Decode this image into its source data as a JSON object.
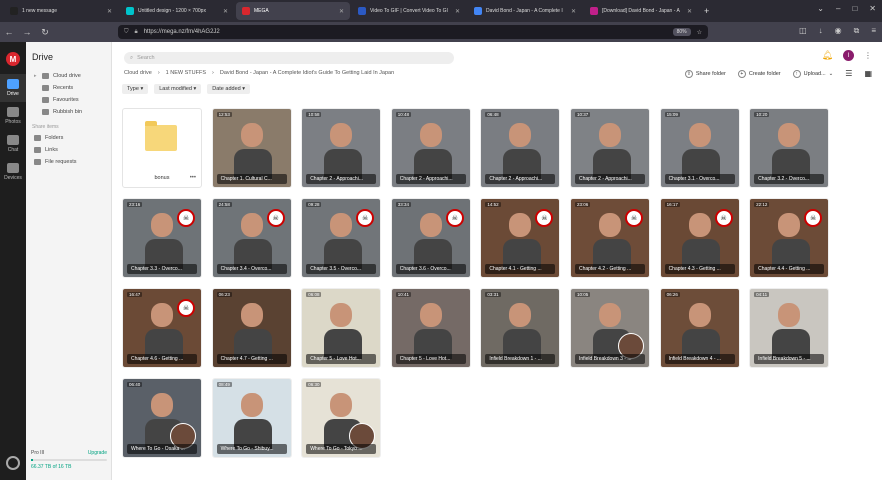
{
  "browser": {
    "tabs": [
      {
        "label": "1 new message",
        "color": "#222"
      },
      {
        "label": "Untitled design - 1200 × 700px",
        "color": "#00c4cc"
      },
      {
        "label": "MEGA",
        "color": "#d9272e",
        "active": true
      },
      {
        "label": "Video To GIF | Convert Video To GI",
        "color": "#2b59c3"
      },
      {
        "label": "David Bond - Japan - A Complete I",
        "color": "#4285f4"
      },
      {
        "label": "[Download] David Bond - Japan - A",
        "color": "#c0208a"
      }
    ],
    "new_tab": "+",
    "url": "https://mega.nz/fm/4hAG2J2",
    "zoom": "80%"
  },
  "rail": {
    "logo": "M",
    "items": [
      {
        "label": "Drive",
        "active": true
      },
      {
        "label": "Photos"
      },
      {
        "label": "Chat"
      },
      {
        "label": "Devices"
      }
    ]
  },
  "sidebar": {
    "title": "Drive",
    "items": [
      "Cloud drive",
      "Recents",
      "Favourites",
      "Rubbish bin"
    ],
    "section": "Share items",
    "share_items": [
      "Folders",
      "Links",
      "File requests"
    ],
    "storage": {
      "plan": "Pro III",
      "upgrade": "Upgrade",
      "used": "66.37 TB of 16 TB",
      "fraction": 0.03
    }
  },
  "main": {
    "search_placeholder": "Search",
    "avatar": "I",
    "breadcrumb": [
      "Cloud drive",
      "1 NEW STUFFS",
      "David Bond - Japan - A Complete Idiot's Guide To Getting Laid In Japan"
    ],
    "actions": [
      "Share folder",
      "Create folder",
      "Upload..."
    ],
    "filters": [
      "Type",
      "Last modified",
      "Date added"
    ],
    "folder": {
      "name": "bonus"
    },
    "files": [
      {
        "name": "Chapter 1. Cultural C...",
        "dur": "12:53",
        "bg": "#8a7b6a"
      },
      {
        "name": "Chapter 2 - Approachi...",
        "dur": "10:58",
        "bg": "#7c7f84"
      },
      {
        "name": "Chapter 2 - Approachi...",
        "dur": "10:48",
        "bg": "#7b7e83"
      },
      {
        "name": "Chapter 2 - Approachi...",
        "dur": "06:48",
        "bg": "#7a7d82"
      },
      {
        "name": "Chapter 2 - Approachi...",
        "dur": "10:37",
        "bg": "#7f8286"
      },
      {
        "name": "Chapter 3.1 - Overco...",
        "dur": "15:09",
        "bg": "#7c7f84"
      },
      {
        "name": "Chapter 3.2 - Overco...",
        "dur": "10:20",
        "bg": "#7b7e82"
      },
      {
        "name": "Chapter 3.3 - Overco...",
        "dur": "23:16",
        "bg": "#6e7377",
        "badge": true
      },
      {
        "name": "Chapter 3.4 - Overco...",
        "dur": "24:58",
        "bg": "#6f7478",
        "badge": true
      },
      {
        "name": "Chapter 3.5 - Overco...",
        "dur": "09:28",
        "bg": "#717579",
        "badge": true
      },
      {
        "name": "Chapter 3.6 - Overco...",
        "dur": "33:34",
        "bg": "#6e7276",
        "badge": true
      },
      {
        "name": "Chapter 4.1 - Getting ...",
        "dur": "14:52",
        "bg": "#6b4a36",
        "badge": true
      },
      {
        "name": "Chapter 4.2 - Getting ...",
        "dur": "23:06",
        "bg": "#6e4c38",
        "badge": true
      },
      {
        "name": "Chapter 4.3 - Getting ...",
        "dur": "16:17",
        "bg": "#6a4935",
        "badge": true
      },
      {
        "name": "Chapter 4.4 - Getting ...",
        "dur": "22:12",
        "bg": "#6c4b37",
        "badge": true
      },
      {
        "name": "Chapter 4.6 - Getting ...",
        "dur": "16:47",
        "bg": "#6b4a36",
        "badge": true
      },
      {
        "name": "Chapter 4.7 - Getting ...",
        "dur": "06:23",
        "bg": "#5a4232"
      },
      {
        "name": "Chapter 5 - Love Hot...",
        "dur": "06:08",
        "bg": "#dcd8c8"
      },
      {
        "name": "Chapter 5 - Love Hot...",
        "dur": "10:41",
        "bg": "#756a66"
      },
      {
        "name": "Infield Breakdown 1 - ...",
        "dur": "03:31",
        "bg": "#6f6a63"
      },
      {
        "name": "Infield Breakdown 3 - ...",
        "dur": "10:05",
        "bg": "#8a8580",
        "inset": true
      },
      {
        "name": "Infield Breakdown 4 - ...",
        "dur": "06:26",
        "bg": "#6d4d39"
      },
      {
        "name": "Infield Breakdown 5 - ...",
        "dur": "04:11",
        "bg": "#c9c6c0"
      },
      {
        "name": "Where To Go - Osaka ...",
        "dur": "06:40",
        "bg": "#5a6068",
        "inset": true
      },
      {
        "name": "Where To Go - Shibuy...",
        "dur": "08:49",
        "bg": "#d5e0e6"
      },
      {
        "name": "Where To Go - Tokyo ...",
        "dur": "06:30",
        "bg": "#e6e2d6",
        "inset": true
      }
    ]
  }
}
